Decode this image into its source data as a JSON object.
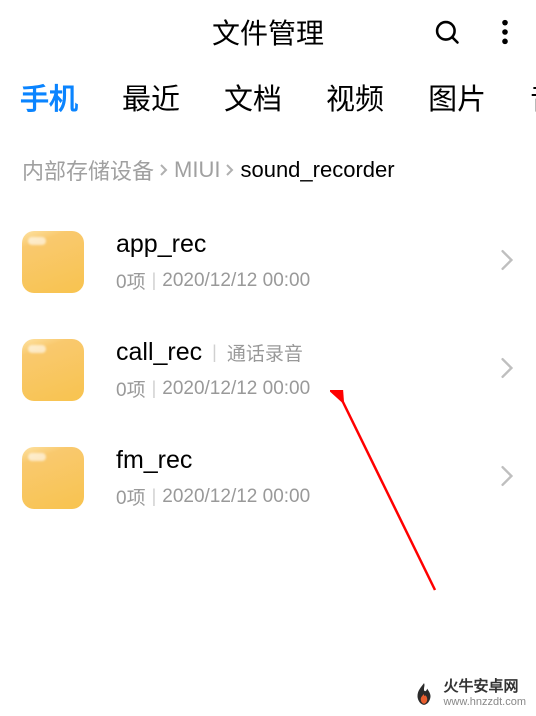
{
  "header": {
    "title": "文件管理"
  },
  "tabs": {
    "items": [
      {
        "label": "手机",
        "active": true
      },
      {
        "label": "最近",
        "active": false
      },
      {
        "label": "文档",
        "active": false
      },
      {
        "label": "视频",
        "active": false
      },
      {
        "label": "图片",
        "active": false
      },
      {
        "label": "音",
        "active": false
      }
    ]
  },
  "breadcrumb": {
    "items": [
      {
        "label": "内部存储设备",
        "current": false
      },
      {
        "label": "MIUI",
        "current": false
      },
      {
        "label": "sound_recorder",
        "current": true
      }
    ]
  },
  "list": {
    "items": [
      {
        "name": "app_rec",
        "tag": "",
        "count": "0项",
        "date": "2020/12/12 00:00"
      },
      {
        "name": "call_rec",
        "tag": "通话录音",
        "count": "0项",
        "date": "2020/12/12 00:00"
      },
      {
        "name": "fm_rec",
        "tag": "",
        "count": "0项",
        "date": "2020/12/12 00:00"
      }
    ]
  },
  "watermark": {
    "title": "火牛安卓网",
    "url": "www.hnzzdt.com"
  }
}
